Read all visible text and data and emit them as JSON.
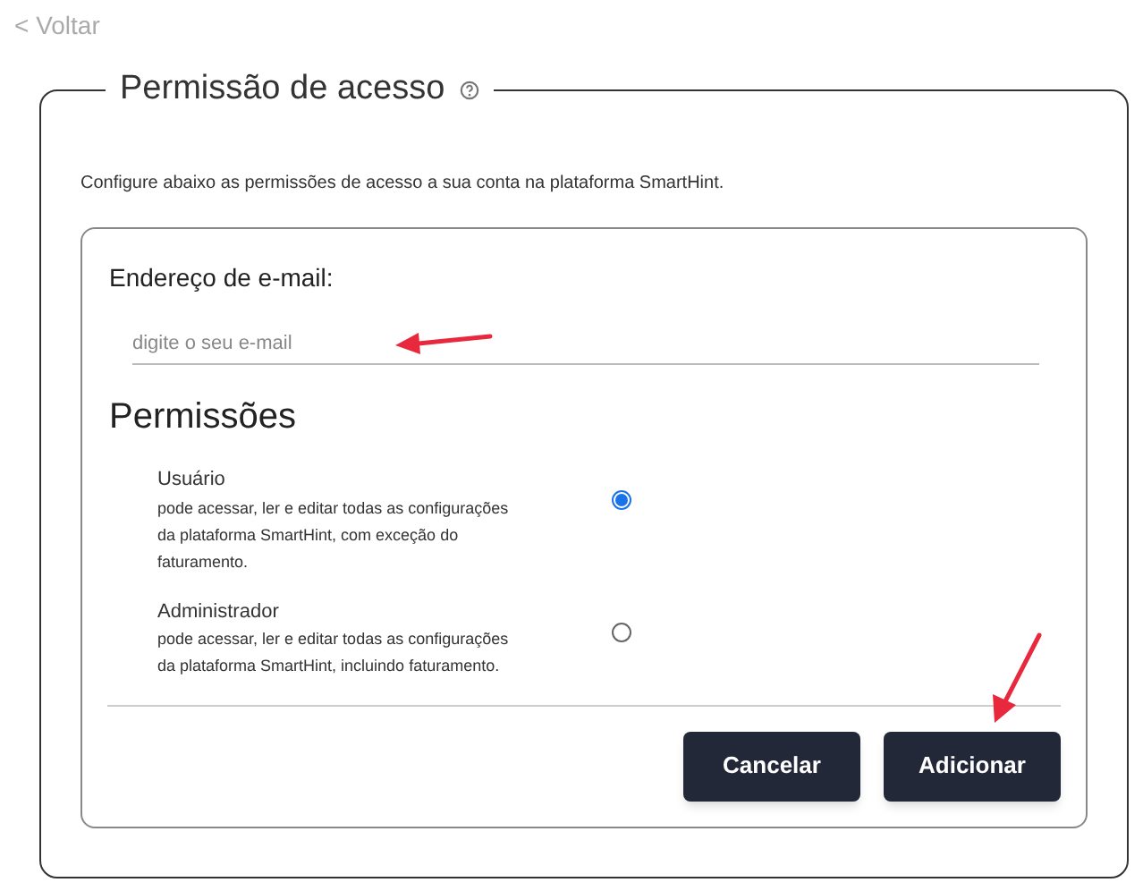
{
  "back_link": "< Voltar",
  "panel": {
    "title": "Permissão de acesso",
    "intro": "Configure abaixo as permissões de acesso a sua conta na plataforma SmartHint."
  },
  "email": {
    "label": "Endereço de e-mail:",
    "placeholder": "digite o seu e-mail"
  },
  "permissions": {
    "heading": "Permissões",
    "options": [
      {
        "title": "Usuário",
        "description": "pode acessar, ler e editar todas as configurações da plataforma SmartHint, com exceção do faturamento.",
        "selected": true
      },
      {
        "title": "Administrador",
        "description": "pode acessar, ler e editar todas as configurações da plataforma SmartHint, incluindo faturamento.",
        "selected": false
      }
    ]
  },
  "buttons": [
    "Cancelar",
    "Adicionar"
  ]
}
